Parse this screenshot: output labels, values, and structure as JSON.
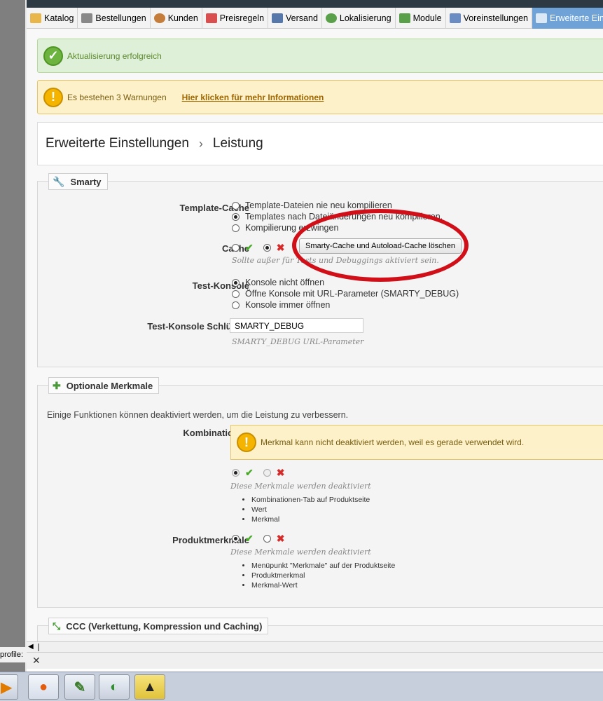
{
  "tabs": [
    {
      "label": "Katalog",
      "icon": "folder-icon",
      "color": "#e8b64a"
    },
    {
      "label": "Bestellungen",
      "icon": "cart-icon",
      "color": "#777777"
    },
    {
      "label": "Kunden",
      "icon": "user-icon",
      "color": "#c47d3a"
    },
    {
      "label": "Preisregeln",
      "icon": "price-tag-icon",
      "color": "#d94f4f"
    },
    {
      "label": "Versand",
      "icon": "truck-icon",
      "color": "#5577aa"
    },
    {
      "label": "Lokalisierung",
      "icon": "globe-icon",
      "color": "#5aa04a"
    },
    {
      "label": "Module",
      "icon": "puzzle-icon",
      "color": "#5aa04a"
    },
    {
      "label": "Voreinstellungen",
      "icon": "settings-page-icon",
      "color": "#6b8cc2"
    },
    {
      "label": "Erweiterte Einstellungen",
      "icon": "wrench-icon",
      "color": "#ffffff"
    }
  ],
  "alerts": {
    "success": "Aktualisierung erfolgreich",
    "warning": "Es bestehen 3 Warnungen",
    "warning_link": "Hier klicken für mehr Informationen"
  },
  "breadcrumb": {
    "parent": "Erweiterte Einstellungen",
    "separator": "›",
    "current": "Leistung"
  },
  "smarty": {
    "legend": "Smarty",
    "template_cache": {
      "label": "Template-Cache",
      "options": [
        "Template-Dateien nie neu kompilieren",
        "Templates nach Dateiänderungen neu kompilieren.",
        "Kompilierung erzwingen"
      ],
      "selected_index": 1
    },
    "cache": {
      "label": "Cache",
      "button": "Smarty-Cache und Autoload-Cache löschen",
      "hint": "Sollte außer für Tests und Debuggings aktiviert sein.",
      "enabled": false
    },
    "test_console": {
      "label": "Test-Konsole",
      "options": [
        "Konsole nicht öffnen",
        "Öffne Konsole mit URL-Parameter (SMARTY_DEBUG)",
        "Konsole immer öffnen"
      ],
      "selected_index": 0
    },
    "test_console_key": {
      "label": "Test-Konsole Schlüssel",
      "value": "SMARTY_DEBUG",
      "hint": "SMARTY_DEBUG URL-Parameter"
    }
  },
  "optional_features": {
    "legend": "Optionale Merkmale",
    "intro": "Einige Funktionen können deaktiviert werden, um die Leistung zu verbessern.",
    "combinations": {
      "label": "Kombinationen",
      "warning": "Merkmal kann nicht deaktiviert werden, weil es gerade verwendet wird.",
      "hint": "Diese Merkmale werden deaktiviert",
      "items": [
        "Kombinationen-Tab auf Produktseite",
        "Wert",
        "Merkmal"
      ]
    },
    "product_features": {
      "label": "Produktmerkmale",
      "hint": "Diese Merkmale werden deaktiviert",
      "items": [
        "Menüpunkt \"Merkmale\" auf der Produktseite",
        "Produktmerkmal",
        "Merkmal-Wert"
      ]
    }
  },
  "ccc": {
    "legend": "CCC (Verkettung, Kompression und Caching)"
  },
  "left_panel": {
    "profile_text": "profile:"
  },
  "taskbar": {
    "items": [
      "media-player-icon",
      "firefox-icon",
      "notepad-icon",
      "camtasia-icon",
      "the-bat-icon"
    ]
  },
  "colors": {
    "success": "#dff0d8",
    "warning": "#fcf1c8",
    "active_tab": "#6fa3d8",
    "annotation": "#d10f19"
  }
}
